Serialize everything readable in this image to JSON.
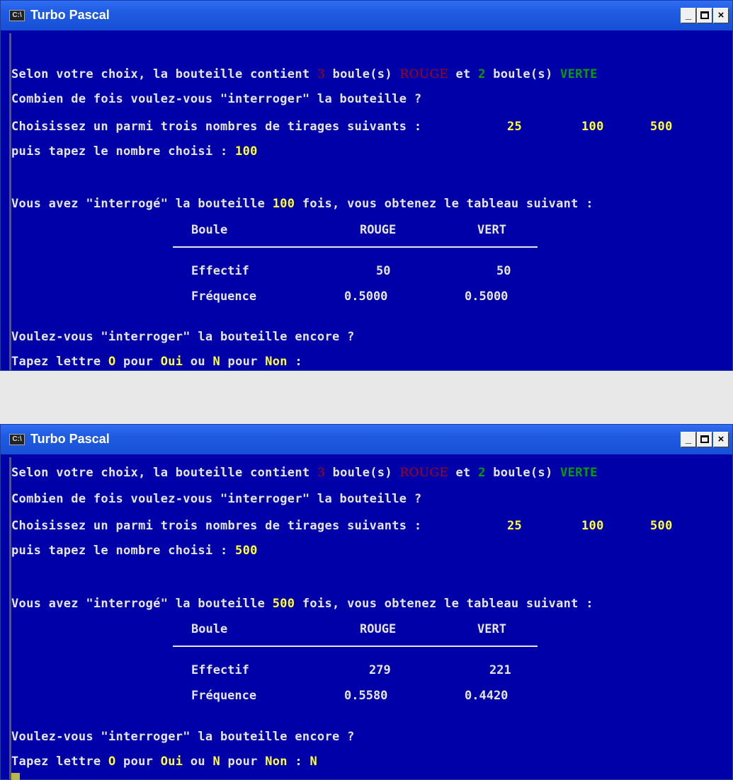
{
  "app_title": "Turbo Pascal",
  "icon_label": "C:\\",
  "buttons": {
    "minimize": "_",
    "close": "×"
  },
  "colors": {
    "console_bg": "#0000a8",
    "text": "#e6e6e6",
    "highlight": "#ffff3a",
    "red": "#b00000",
    "green": "#00a000"
  },
  "common": {
    "line1_prefix": "Selon votre choix, la bouteille contient ",
    "red_count": "3",
    "line1_mid": " boule(s) ",
    "rouge_word": "ROUGE",
    "line1_et": " et ",
    "green_count": "2",
    "line1_mid2": " boule(s) ",
    "verte_word": "VERTE",
    "line2": "Combien de fois voulez-vous \"interroger\" la bouteille ?",
    "line3": "Choisissez un parmi trois nombres de tirages suivants : ",
    "opt1": "25",
    "opt2": "100",
    "opt3": "500",
    "line4": "puis tapez le nombre choisi : ",
    "line5_pre": "Vous avez \"interrogé\" la bouteille ",
    "line5_post": " fois, vous obtenez le tableau suivant :",
    "hdr_boule": "Boule",
    "hdr_rouge": "ROUGE",
    "hdr_vert": "VERT",
    "row_effectif": "Effectif",
    "row_frequence": "Fréquence",
    "line6": "Voulez-vous \"interroger\" la bouteille encore ?",
    "line7_a": "Tapez lettre ",
    "letter_o": "O",
    "line7_b": " pour ",
    "oui": "Oui",
    "line7_c": " ou ",
    "letter_n": "N",
    "line7_d": " pour ",
    "non": "Non",
    "line7_e": " :"
  },
  "windows": [
    {
      "chosen": "100",
      "eff_rouge": "50",
      "eff_vert": "50",
      "freq_rouge": "0.5000",
      "freq_vert": "0.5000",
      "answer": ""
    },
    {
      "chosen": "500",
      "eff_rouge": "279",
      "eff_vert": "221",
      "freq_rouge": "0.5580",
      "freq_vert": "0.4420",
      "answer": " N"
    }
  ]
}
